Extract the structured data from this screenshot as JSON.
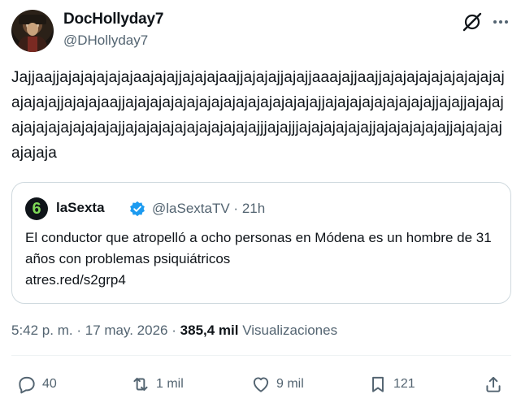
{
  "author": {
    "display_name": "DocHollyday7",
    "handle": "@DHollyday7"
  },
  "tweet": {
    "text": "Jajjaajjajajajajajajaajajajjajajajaajjajajajjajajjaaajajjaajjajajajajajajajajajajajajajajjajajajaajjajajajajajajajajajajajajajajajajjajajajajajajajajajjajajjajajajajajajajajajajajajjajajajajajajajajajajajjjajajjjajajajajajajjajajajajajajjajajajajajajaja"
  },
  "quote": {
    "name": "laSexta",
    "handle": "@laSextaTV",
    "separator": "·",
    "time": "21h",
    "text": "El conductor que atropelló a ocho personas en Módena es un hombre de 31 años con problemas psiquiátricos",
    "link": "atres.red/s2grp4",
    "logo_glyph": "6"
  },
  "meta": {
    "time": "5:42 p. m.",
    "dot": "·",
    "date": "17 may. 2026",
    "views_count": "385,4 mil",
    "views_label": "Visualizaciones"
  },
  "actions": {
    "reply_count": "40",
    "retweet_count": "1 mil",
    "like_count": "9 mil",
    "bookmark_count": "121"
  },
  "icons": {
    "reply": "reply-icon",
    "retweet": "retweet-icon",
    "like": "heart-icon",
    "bookmark": "bookmark-icon",
    "share": "share-icon",
    "grok": "grok-icon",
    "more": "more-icon",
    "verified": "verified-icon"
  },
  "colors": {
    "text": "#0f1419",
    "secondary": "#536471",
    "verified_blue": "#1d9bf0",
    "border": "#cfd9de",
    "logo_green": "#7ed957"
  }
}
